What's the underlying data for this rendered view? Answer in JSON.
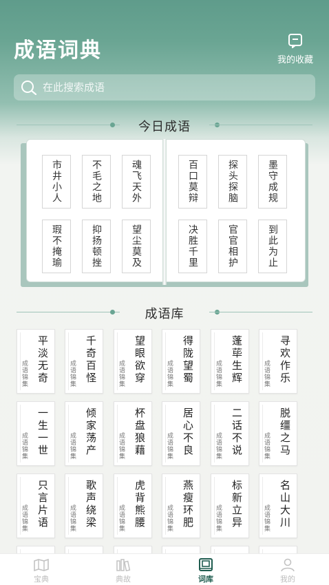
{
  "header": {
    "title": "成语词典",
    "favorites_label": "我的收藏"
  },
  "search": {
    "placeholder": "在此搜索成语"
  },
  "today": {
    "title": "今日成语",
    "left_page": [
      "市井小人",
      "不毛之地",
      "魂飞天外",
      "瑕不掩瑜",
      "抑扬顿挫",
      "望尘莫及"
    ],
    "right_page": [
      "百口莫辩",
      "探头探脑",
      "墨守成规",
      "决胜千里",
      "官官相护",
      "到此为止"
    ]
  },
  "library": {
    "title": "成语库",
    "card_sublabel": "成语锦集",
    "rows": [
      [
        "平淡无奇",
        "千奇百怪",
        "望眼欲穿",
        "得陇望蜀",
        "蓬荜生辉",
        "寻欢作乐"
      ],
      [
        "一生一世",
        "倾家荡产",
        "杯盘狼藉",
        "居心不良",
        "二话不说",
        "脱缰之马"
      ],
      [
        "只言片语",
        "歌声绕梁",
        "虎背熊腰",
        "燕瘦环肥",
        "标新立异",
        "名山大川"
      ]
    ]
  },
  "tabbar": {
    "items": [
      {
        "label": "宝典",
        "icon": "map-book-icon",
        "active": false
      },
      {
        "label": "典故",
        "icon": "books-icon",
        "active": false
      },
      {
        "label": "词库",
        "icon": "dictionary-icon",
        "active": true
      },
      {
        "label": "我的",
        "icon": "user-icon",
        "active": false
      }
    ]
  },
  "colors": {
    "primary": "#5f9c8b",
    "active_tab": "#1f5c4f",
    "inactive_tab": "#bdbdbd"
  }
}
